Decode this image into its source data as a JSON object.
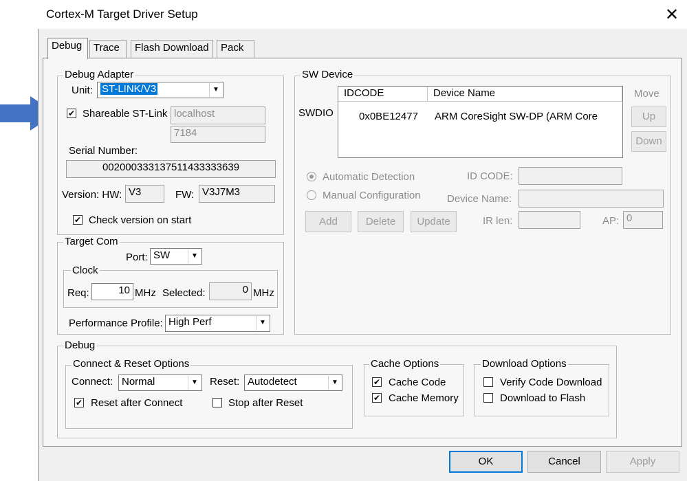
{
  "window": {
    "title": "Cortex-M Target Driver Setup"
  },
  "tabs": [
    {
      "label": "Debug",
      "active": true
    },
    {
      "label": "Trace",
      "active": false
    },
    {
      "label": "Flash Download",
      "active": false
    },
    {
      "label": "Pack",
      "active": false
    }
  ],
  "debug_adapter": {
    "group_label": "Debug Adapter",
    "unit_label": "Unit:",
    "unit_value": "ST-LINK/V3",
    "shareable_label": "Shareable ST-Link",
    "shareable_checked": true,
    "host": "localhost",
    "port": "7184",
    "serial_label": "Serial Number:",
    "serial_value": "002000333137511433333639",
    "version_hw_label": "Version: HW:",
    "version_hw_value": "V3",
    "version_fw_label": "FW:",
    "version_fw_value": "V3J7M3",
    "check_version_label": "Check version on start",
    "check_version_checked": true
  },
  "target_com": {
    "group_label": "Target Com",
    "port_label": "Port:",
    "port_value": "SW",
    "clock_label": "Clock",
    "req_label": "Req:",
    "req_value": "10",
    "req_unit": "MHz",
    "selected_label": "Selected:",
    "selected_value": "0",
    "selected_unit": "MHz",
    "perf_label": "Performance Profile:",
    "perf_value": "High Perf"
  },
  "sw_device": {
    "group_label": "SW Device",
    "row_label": "SWDIO",
    "columns": [
      "IDCODE",
      "Device Name"
    ],
    "rows": [
      {
        "idcode": "0x0BE12477",
        "device_name": "ARM CoreSight SW-DP (ARM Core"
      }
    ],
    "move_label": "Move",
    "up_label": "Up",
    "down_label": "Down",
    "auto_detect_label": "Automatic Detection",
    "manual_config_label": "Manual Configuration",
    "id_code_label": "ID CODE:",
    "device_name_label": "Device Name:",
    "add_label": "Add",
    "delete_label": "Delete",
    "update_label": "Update",
    "ir_len_label": "IR len:",
    "ap_label": "AP:",
    "ap_value": "0"
  },
  "debug": {
    "group_label": "Debug",
    "connect_reset": {
      "group_label": "Connect & Reset Options",
      "connect_label": "Connect:",
      "connect_value": "Normal",
      "reset_label": "Reset:",
      "reset_value": "Autodetect",
      "reset_after_connect_label": "Reset after Connect",
      "reset_after_connect_checked": true,
      "stop_after_reset_label": "Stop after Reset",
      "stop_after_reset_checked": false
    },
    "cache": {
      "group_label": "Cache Options",
      "cache_code_label": "Cache Code",
      "cache_code_checked": true,
      "cache_memory_label": "Cache Memory",
      "cache_memory_checked": true
    },
    "download": {
      "group_label": "Download Options",
      "verify_label": "Verify Code Download",
      "verify_checked": false,
      "download_flash_label": "Download to Flash",
      "download_flash_checked": false
    }
  },
  "footer": {
    "ok_label": "OK",
    "cancel_label": "Cancel",
    "apply_label": "Apply"
  },
  "annotation": {
    "arrow_color": "#4472c4"
  }
}
